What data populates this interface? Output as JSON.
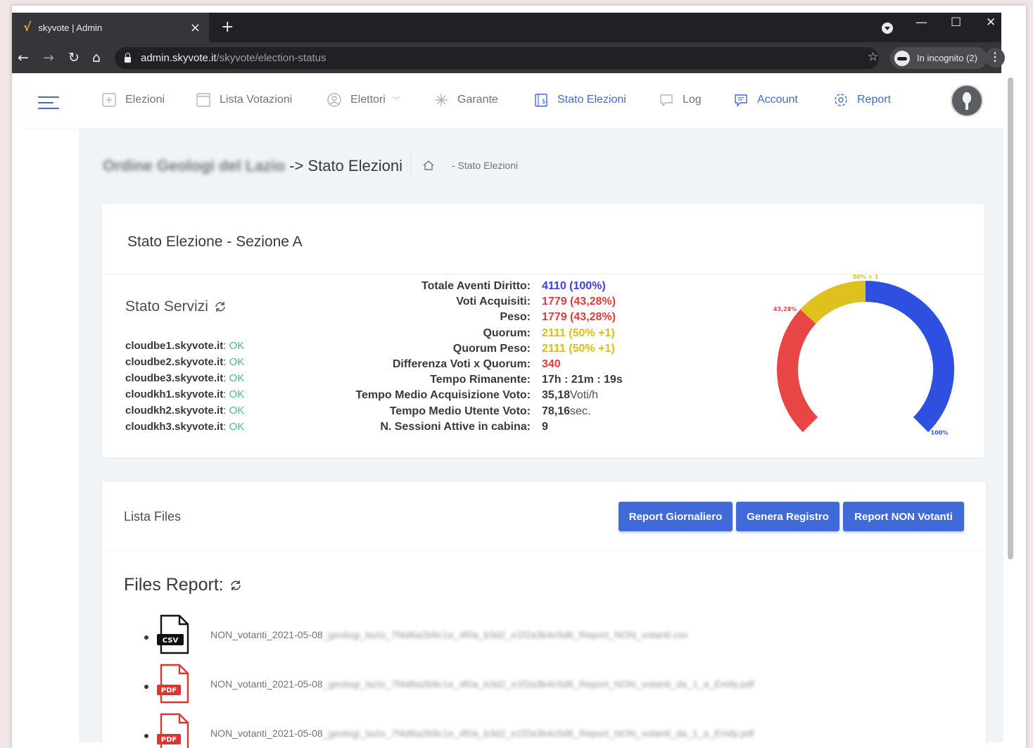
{
  "browser": {
    "tab_title": "skyvote | Admin",
    "tab_close": "×",
    "new_tab": "+",
    "url_host": "admin.skyvote.it",
    "url_path": "/skyvote/election-status",
    "incognito": "In incognito (2)",
    "minimize": "—",
    "maximize": "☐",
    "close": "✕"
  },
  "nav": {
    "items": [
      {
        "label": "Elezioni",
        "icon": "add-box-icon"
      },
      {
        "label": "Lista Votazioni",
        "icon": "window-icon"
      },
      {
        "label": "Elettori",
        "icon": "user-circle-icon",
        "has_dropdown": true
      },
      {
        "label": "Garante",
        "icon": "sparkle-icon"
      },
      {
        "label": "Stato Elezioni",
        "icon": "ballot-icon",
        "active": true
      },
      {
        "label": "Log",
        "icon": "comment-icon"
      },
      {
        "label": "Account",
        "icon": "comment-icon",
        "accent": true
      },
      {
        "label": "Report",
        "icon": "gear-icon",
        "accent": true
      }
    ]
  },
  "breadcrumb": {
    "org_blurred": "Ordine Geologi del Lazio",
    "title": "-> Stato Elezioni",
    "trail": "- Stato Elezioni"
  },
  "election": {
    "title": "Stato Elezione - Sezione A",
    "services_title": "Stato Servizi",
    "services": [
      {
        "host": "cloudbe1.skyvote.it",
        "status": "OK"
      },
      {
        "host": "cloudbe2.skyvote.it",
        "status": "OK"
      },
      {
        "host": "cloudbe3.skyvote.it",
        "status": "OK"
      },
      {
        "host": "cloudkh1.skyvote.it",
        "status": "OK"
      },
      {
        "host": "cloudkh2.skyvote.it",
        "status": "OK"
      },
      {
        "host": "cloudkh3.skyvote.it",
        "status": "OK"
      }
    ],
    "stats": [
      {
        "label": "Totale Aventi Diritto:",
        "value": "4110 (100%)",
        "style": "blue"
      },
      {
        "label": "Voti Acquisiti:",
        "value": "1779 (43,28%)",
        "style": "red"
      },
      {
        "label": "Peso:",
        "value": "1779 (43,28%)",
        "style": "red"
      },
      {
        "label": "Quorum:",
        "value": "2111 (50% +1)",
        "style": "yellow"
      },
      {
        "label": "Quorum Peso:",
        "value": "2111 (50% +1)",
        "style": "yellow"
      },
      {
        "label": "Differenza Voti x Quorum:",
        "value": "340",
        "style": "red"
      },
      {
        "label": "Tempo Rimanente:",
        "value": "17h : 21m : 19s",
        "style": "bold"
      },
      {
        "label": "Tempo Medio Acquisizione Voto:",
        "value": "35,18",
        "unit": " Voti/h",
        "style": "bold"
      },
      {
        "label": "Tempo Medio Utente Voto:",
        "value": "78,16",
        "unit": " sec.",
        "style": "bold"
      },
      {
        "label": "N. Sessioni Attive in cabina:",
        "value": "9",
        "style": "bold"
      }
    ],
    "gauge": {
      "label_acquired": "43,28%",
      "label_quorum": "50% + 1",
      "label_total": "100%",
      "acquired_fraction": 0.4328,
      "quorum_fraction": 0.5,
      "colors": {
        "acquired": "#e84545",
        "quorum": "#dec01f",
        "total": "#2f4fe0"
      }
    }
  },
  "files": {
    "title": "Lista Files",
    "buttons": {
      "daily": "Report Giornaliero",
      "register": "Genera Registro",
      "non_voters": "Report NON Votanti"
    },
    "report_title": "Files Report:",
    "items": [
      {
        "type": "CSV",
        "name": "NON_votanti_2021-05-08",
        "blurred": "_geologi_lazio_7f4d6a2b9c1e_4f0a_b3d2_e1f2a3b4c5d6_Report_NON_votanti.csv"
      },
      {
        "type": "PDF",
        "name": "NON_votanti_2021-05-08",
        "blurred": "_geologi_lazio_7f4d6a2b9c1e_4f0a_b3d2_e1f2a3b4c5d6_Report_NON_votanti_da_1_a_Emily.pdf"
      },
      {
        "type": "PDF",
        "name": "NON_votanti_2021-05-08",
        "blurred": "_geologi_lazio_7f4d6a2b9c1e_4f0a_b3d2_e1f2a3b4c5d6_Report_NON_votanti_da_1_a_Emily.pdf"
      }
    ]
  }
}
